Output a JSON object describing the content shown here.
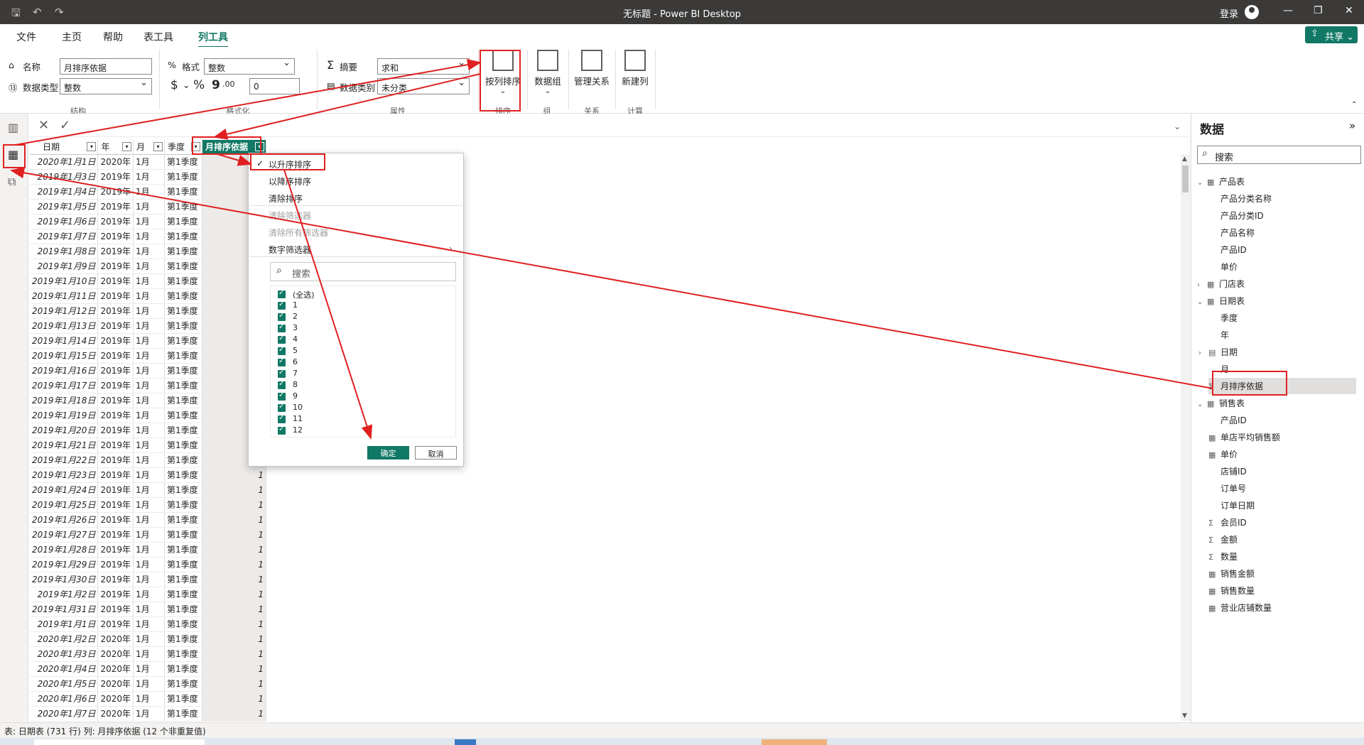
{
  "window": {
    "title": "无标题 - Power BI Desktop",
    "login": "登录",
    "minimize": "—",
    "restore": "❐",
    "close": "✕"
  },
  "quick_access": {
    "save": "🖫",
    "undo": "↶",
    "redo": "↷"
  },
  "menu": {
    "tabs": [
      "文件",
      "主页",
      "帮助",
      "表工具",
      "列工具"
    ],
    "active": "列工具",
    "share": "共享"
  },
  "ribbon": {
    "structure": {
      "name_label": "名称",
      "name_value": "月排序依据",
      "type_label": "数据类型",
      "type_value": "整数",
      "group": "结构"
    },
    "format": {
      "format_label": "格式",
      "format_value": "整数",
      "currency": "$",
      "percent": "%",
      "comma": "9",
      "decimals": ".00",
      "decimal_places": "0",
      "group": "格式化"
    },
    "properties": {
      "summary_label": "摘要",
      "summary_value": "求和",
      "category_label": "数据类别",
      "category_value": "未分类",
      "group": "属性"
    },
    "sort": {
      "label": "按列排序",
      "group": "排序"
    },
    "groups": {
      "label": "数据组",
      "group": "组"
    },
    "relations": {
      "label": "管理关系",
      "group": "关系"
    },
    "calc": {
      "label": "新建列",
      "group": "计算"
    }
  },
  "table": {
    "columns": [
      "日期",
      "年",
      "月",
      "季度",
      "月排序依据"
    ],
    "rows": [
      [
        "2020年1月1日",
        "2020年",
        "1月",
        "第1季度",
        ""
      ],
      [
        "2019年1月3日",
        "2019年",
        "1月",
        "第1季度",
        ""
      ],
      [
        "2019年1月4日",
        "2019年",
        "1月",
        "第1季度",
        ""
      ],
      [
        "2019年1月5日",
        "2019年",
        "1月",
        "第1季度",
        ""
      ],
      [
        "2019年1月6日",
        "2019年",
        "1月",
        "第1季度",
        ""
      ],
      [
        "2019年1月7日",
        "2019年",
        "1月",
        "第1季度",
        ""
      ],
      [
        "2019年1月8日",
        "2019年",
        "1月",
        "第1季度",
        ""
      ],
      [
        "2019年1月9日",
        "2019年",
        "1月",
        "第1季度",
        ""
      ],
      [
        "2019年1月10日",
        "2019年",
        "1月",
        "第1季度",
        ""
      ],
      [
        "2019年1月11日",
        "2019年",
        "1月",
        "第1季度",
        ""
      ],
      [
        "2019年1月12日",
        "2019年",
        "1月",
        "第1季度",
        ""
      ],
      [
        "2019年1月13日",
        "2019年",
        "1月",
        "第1季度",
        ""
      ],
      [
        "2019年1月14日",
        "2019年",
        "1月",
        "第1季度",
        ""
      ],
      [
        "2019年1月15日",
        "2019年",
        "1月",
        "第1季度",
        ""
      ],
      [
        "2019年1月16日",
        "2019年",
        "1月",
        "第1季度",
        ""
      ],
      [
        "2019年1月17日",
        "2019年",
        "1月",
        "第1季度",
        ""
      ],
      [
        "2019年1月18日",
        "2019年",
        "1月",
        "第1季度",
        ""
      ],
      [
        "2019年1月19日",
        "2019年",
        "1月",
        "第1季度",
        ""
      ],
      [
        "2019年1月20日",
        "2019年",
        "1月",
        "第1季度",
        ""
      ],
      [
        "2019年1月21日",
        "2019年",
        "1月",
        "第1季度",
        ""
      ],
      [
        "2019年1月22日",
        "2019年",
        "1月",
        "第1季度",
        ""
      ],
      [
        "2019年1月23日",
        "2019年",
        "1月",
        "第1季度",
        "1"
      ],
      [
        "2019年1月24日",
        "2019年",
        "1月",
        "第1季度",
        "1"
      ],
      [
        "2019年1月25日",
        "2019年",
        "1月",
        "第1季度",
        "1"
      ],
      [
        "2019年1月26日",
        "2019年",
        "1月",
        "第1季度",
        "1"
      ],
      [
        "2019年1月27日",
        "2019年",
        "1月",
        "第1季度",
        "1"
      ],
      [
        "2019年1月28日",
        "2019年",
        "1月",
        "第1季度",
        "1"
      ],
      [
        "2019年1月29日",
        "2019年",
        "1月",
        "第1季度",
        "1"
      ],
      [
        "2019年1月30日",
        "2019年",
        "1月",
        "第1季度",
        "1"
      ],
      [
        "2019年1月2日",
        "2019年",
        "1月",
        "第1季度",
        "1"
      ],
      [
        "2019年1月31日",
        "2019年",
        "1月",
        "第1季度",
        "1"
      ],
      [
        "2019年1月1日",
        "2019年",
        "1月",
        "第1季度",
        "1"
      ],
      [
        "2020年1月2日",
        "2020年",
        "1月",
        "第1季度",
        "1"
      ],
      [
        "2020年1月3日",
        "2020年",
        "1月",
        "第1季度",
        "1"
      ],
      [
        "2020年1月4日",
        "2020年",
        "1月",
        "第1季度",
        "1"
      ],
      [
        "2020年1月5日",
        "2020年",
        "1月",
        "第1季度",
        "1"
      ],
      [
        "2020年1月6日",
        "2020年",
        "1月",
        "第1季度",
        "1"
      ],
      [
        "2020年1月7日",
        "2020年",
        "1月",
        "第1季度",
        "1"
      ]
    ]
  },
  "dropdown": {
    "sort_asc": "以升序排序",
    "sort_desc": "以降序排序",
    "clear_sort": "清除排序",
    "clear_filter": "清除筛选器",
    "clear_all_filters": "清除所有筛选器",
    "number_filters": "数字筛选器",
    "search_placeholder": "搜索",
    "items": [
      "(全选)",
      "1",
      "2",
      "3",
      "4",
      "5",
      "6",
      "7",
      "8",
      "9",
      "10",
      "11",
      "12"
    ],
    "ok": "确定",
    "cancel": "取消"
  },
  "data_pane": {
    "title": "数据",
    "search_placeholder": "搜索",
    "tables": [
      {
        "name": "产品表",
        "expanded": true,
        "fields": [
          "产品分类名称",
          "产品分类ID",
          "产品名称",
          "产品ID",
          "单价"
        ]
      },
      {
        "name": "门店表",
        "expanded": false,
        "fields": []
      },
      {
        "name": "日期表",
        "expanded": true,
        "fields": [
          "季度",
          "年",
          "日期",
          "月",
          "月排序依据"
        ]
      },
      {
        "name": "销售表",
        "expanded": true,
        "fields": [
          "产品ID",
          "单店平均销售额",
          "单价",
          "店铺ID",
          "订单号",
          "订单日期",
          "会员ID",
          "金额",
          "数量",
          "销售金额",
          "销售数量",
          "营业店铺数量"
        ]
      }
    ]
  },
  "status": "表: 日期表 (731 行) 列: 月排序依据 (12 个非重复值)",
  "colors": {
    "accent": "#117865",
    "annotation": "#e02020"
  }
}
